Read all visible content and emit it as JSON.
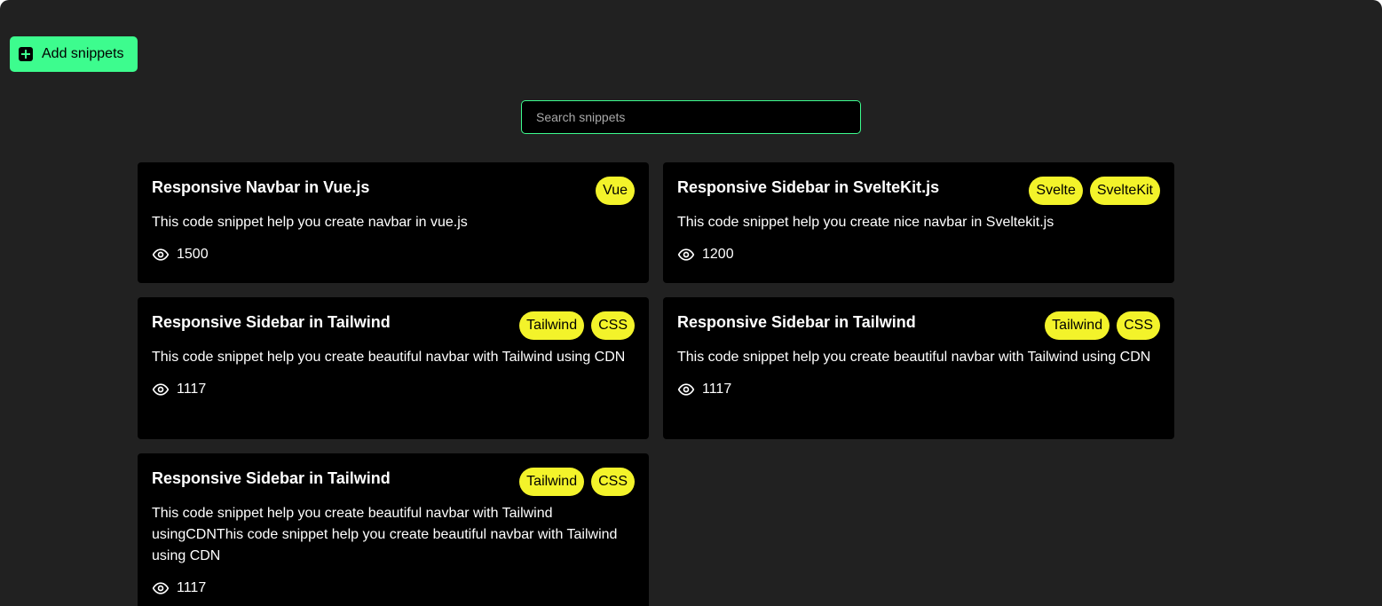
{
  "toolbar": {
    "add_label": "Add snippets"
  },
  "search": {
    "placeholder": "Search snippets",
    "value": ""
  },
  "colors": {
    "background": "#212121",
    "card": "#000000",
    "accent": "#3dfc8e",
    "tag": "#f3f32a"
  },
  "snippets": [
    {
      "title": "Responsive Navbar in Vue.js",
      "tags": [
        "Vue"
      ],
      "description": "This code snippet help you create navbar in vue.js",
      "views": "1500",
      "views_icon": "eye-icon"
    },
    {
      "title": "Responsive Sidebar in SvelteKit.js",
      "tags": [
        "Svelte",
        "SvelteKit"
      ],
      "description": "This code snippet help you create nice navbar in Sveltekit.js",
      "views": "1200",
      "views_icon": "eye-icon"
    },
    {
      "title": "Responsive Sidebar in Tailwind",
      "tags": [
        "Tailwind",
        "CSS"
      ],
      "description": "This code snippet help you create beautiful navbar with Tailwind using CDN",
      "views": "1117",
      "views_icon": "eye-icon"
    },
    {
      "title": "Responsive Sidebar in Tailwind",
      "tags": [
        "Tailwind",
        "CSS"
      ],
      "description": "This code snippet help you create beautiful navbar with Tailwind using CDN",
      "views": "1117",
      "views_icon": "eye-icon"
    },
    {
      "title": "Responsive Sidebar in Tailwind",
      "tags": [
        "Tailwind",
        "CSS"
      ],
      "description": "This code snippet help you create beautiful navbar with Tailwind usingCDNThis code snippet help you create beautiful navbar with Tailwind using CDN",
      "views": "1117",
      "views_icon": "eye-icon"
    }
  ]
}
